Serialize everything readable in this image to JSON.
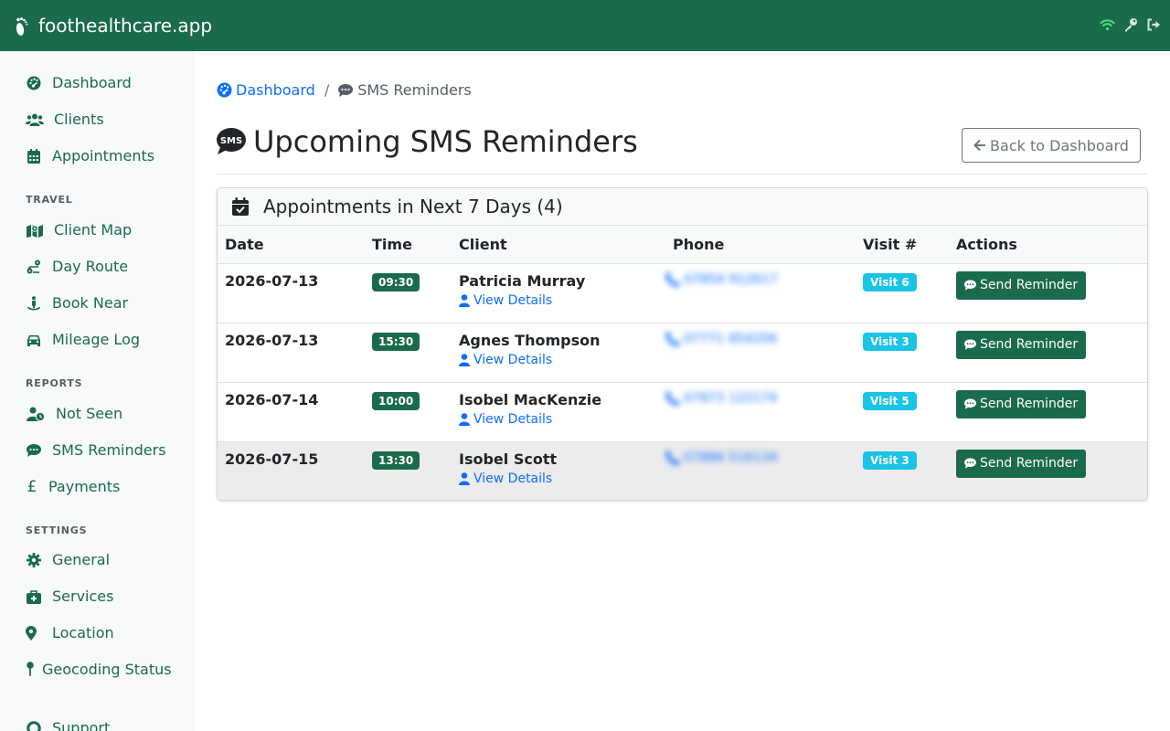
{
  "app": {
    "brand": "foothealthcare.app",
    "icons": [
      "wifi-icon",
      "key-icon",
      "sign-out-icon"
    ],
    "colors": {
      "brand": "#1a6b4b",
      "link": "#0d6efd",
      "visit_badge": "#19c4e6",
      "wifi": "#47e07a"
    }
  },
  "sidebar": {
    "main": [
      {
        "label": "Dashboard",
        "icon": "gauge-icon"
      },
      {
        "label": "Clients",
        "icon": "users-icon"
      },
      {
        "label": "Appointments",
        "icon": "calendar-icon"
      }
    ],
    "travel_heading": "TRAVEL",
    "travel": [
      {
        "label": "Client Map",
        "icon": "map-icon"
      },
      {
        "label": "Day Route",
        "icon": "route-icon"
      },
      {
        "label": "Book Near",
        "icon": "person-pin-icon"
      },
      {
        "label": "Mileage Log",
        "icon": "car-icon"
      }
    ],
    "reports_heading": "REPORTS",
    "reports": [
      {
        "label": "Not Seen",
        "icon": "user-clock-icon"
      },
      {
        "label": "SMS Reminders",
        "icon": "sms-icon"
      },
      {
        "label": "Payments",
        "icon": "pound-icon"
      }
    ],
    "settings_heading": "SETTINGS",
    "settings": [
      {
        "label": "General",
        "icon": "cog-icon"
      },
      {
        "label": "Services",
        "icon": "medkit-icon"
      },
      {
        "label": "Location",
        "icon": "location-pin-icon"
      },
      {
        "label": "Geocoding Status",
        "icon": "map-pin-icon"
      },
      {
        "label": "Support",
        "icon": "life-ring-icon"
      }
    ]
  },
  "breadcrumb": {
    "home": "Dashboard",
    "current": "SMS Reminders"
  },
  "page": {
    "title": "Upcoming SMS Reminders",
    "back_button": "Back to Dashboard",
    "card_title": "Appointments in Next 7 Days (4)"
  },
  "table": {
    "columns": [
      "Date",
      "Time",
      "Client",
      "Phone",
      "Visit #",
      "Actions"
    ],
    "rows": [
      {
        "date": "2026-07-13",
        "time": "09:30",
        "client": "Patricia Murray",
        "details": "View Details",
        "phone": "07854 912617",
        "visit": "Visit 6",
        "action": "Send Reminder"
      },
      {
        "date": "2026-07-13",
        "time": "15:30",
        "client": "Agnes Thompson",
        "details": "View Details",
        "phone": "07771 854206",
        "visit": "Visit 3",
        "action": "Send Reminder"
      },
      {
        "date": "2026-07-14",
        "time": "10:00",
        "client": "Isobel MacKenzie",
        "details": "View Details",
        "phone": "07873 122174",
        "visit": "Visit 5",
        "action": "Send Reminder"
      },
      {
        "date": "2026-07-15",
        "time": "13:30",
        "client": "Isobel Scott",
        "details": "View Details",
        "phone": "07886 516134",
        "visit": "Visit 3",
        "action": "Send Reminder"
      }
    ]
  }
}
